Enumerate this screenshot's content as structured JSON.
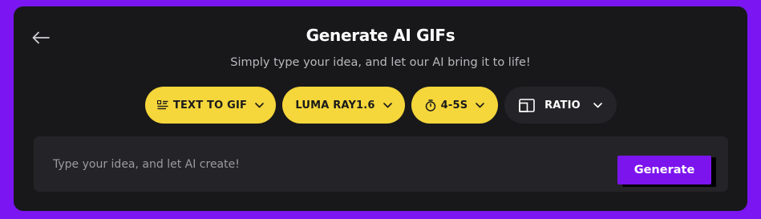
{
  "header": {
    "title": "Generate AI GIFs",
    "subtitle": "Simply type your idea, and let our AI bring it to life!",
    "back_icon": "arrow-left-icon"
  },
  "options": {
    "mode": {
      "label": "TEXT TO GIF",
      "icon": "text-lines-icon"
    },
    "model": {
      "label": "LUMA RAY1.6"
    },
    "duration": {
      "label": "4-5S",
      "icon": "stopwatch-icon"
    },
    "ratio": {
      "label": "RATIO",
      "icon": "aspect-ratio-icon"
    }
  },
  "prompt": {
    "placeholder": "Type your idea, and let AI create!",
    "value": ""
  },
  "generate_button": {
    "label": "Generate"
  },
  "colors": {
    "background": "#7b16f2",
    "card": "#18181a",
    "pill_yellow": "#f5d63b",
    "pill_dark": "#242428",
    "accent": "#7c14ee"
  }
}
